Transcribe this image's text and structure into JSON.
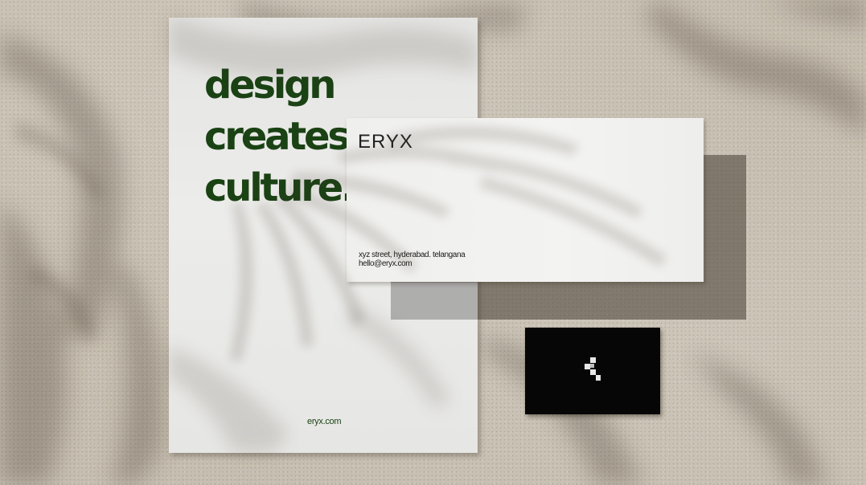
{
  "scene": {
    "background_color": "#c6beb0",
    "shadow_color": "#3c3328"
  },
  "poster": {
    "headline_lines": [
      "design",
      "creates",
      "culture."
    ],
    "website": "eryx.com",
    "text_color": "#1a4214",
    "paper_color": "#ececea"
  },
  "letterhead": {
    "brand": "ERYX",
    "address_line": "xyz street, hyderabad. telangana",
    "email": "hello@eryx.com",
    "paper_color": "#f1f1ef"
  },
  "business_card": {
    "color": "#060606",
    "logo_icon": "pixel-chevron-left-icon",
    "logo_color": "#e6e6e6"
  }
}
